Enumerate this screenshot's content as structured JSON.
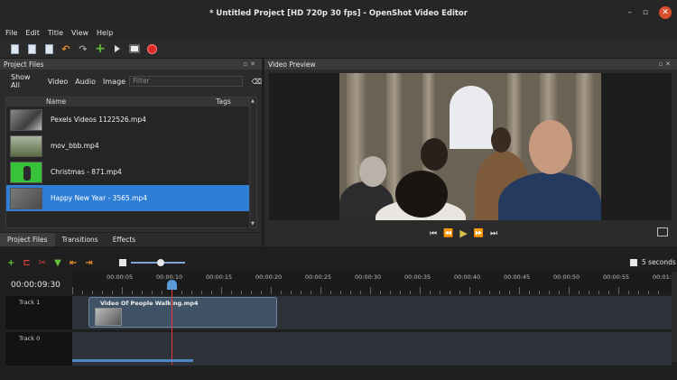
{
  "window": {
    "title": "* Untitled Project [HD 720p 30 fps] - OpenShot Video Editor",
    "controls": [
      "–",
      "▫",
      "✕"
    ]
  },
  "menu": [
    "File",
    "Edit",
    "Title",
    "View",
    "Help"
  ],
  "toolbar": {
    "icons": [
      "new-project-icon",
      "open-project-icon",
      "save-project-icon",
      "undo-icon",
      "redo-icon",
      "import-files-icon",
      "play-icon",
      "export-film-icon",
      "record-icon"
    ]
  },
  "project_files": {
    "title": "Project Files",
    "filters": [
      "Show All",
      "Video",
      "Audio",
      "Image"
    ],
    "filter_placeholder": "Filter",
    "columns": [
      "Name",
      "Tags"
    ],
    "files": [
      {
        "name": "Pexels Videos 1122526.mp4"
      },
      {
        "name": "mov_bbb.mp4"
      },
      {
        "name": "Christmas - 871.mp4"
      },
      {
        "name": "Happy New Year - 3565.mp4",
        "selected": true
      }
    ],
    "tabs": [
      "Project Files",
      "Transitions",
      "Effects"
    ],
    "active_tab": "Project Files"
  },
  "video_preview": {
    "title": "Video Preview",
    "transport": [
      "⏮",
      "⏪",
      "▶",
      "⏩",
      "⏭"
    ]
  },
  "timeline": {
    "current_time": "00:00:09:30",
    "ruler_labels": [
      "00:00:05",
      "00:00:10",
      "00:00:15",
      "00:00:20",
      "00:00:25",
      "00:00:30",
      "00:00:35",
      "00:00:40",
      "00:00:45",
      "00:00:50",
      "00:00:55",
      "00:01:00"
    ],
    "seconds_label": "5 seconds",
    "tracks": [
      {
        "name": "Track 1"
      },
      {
        "name": "Track 0"
      }
    ],
    "clip": {
      "name": "Video Of People Walking.mp4"
    }
  }
}
